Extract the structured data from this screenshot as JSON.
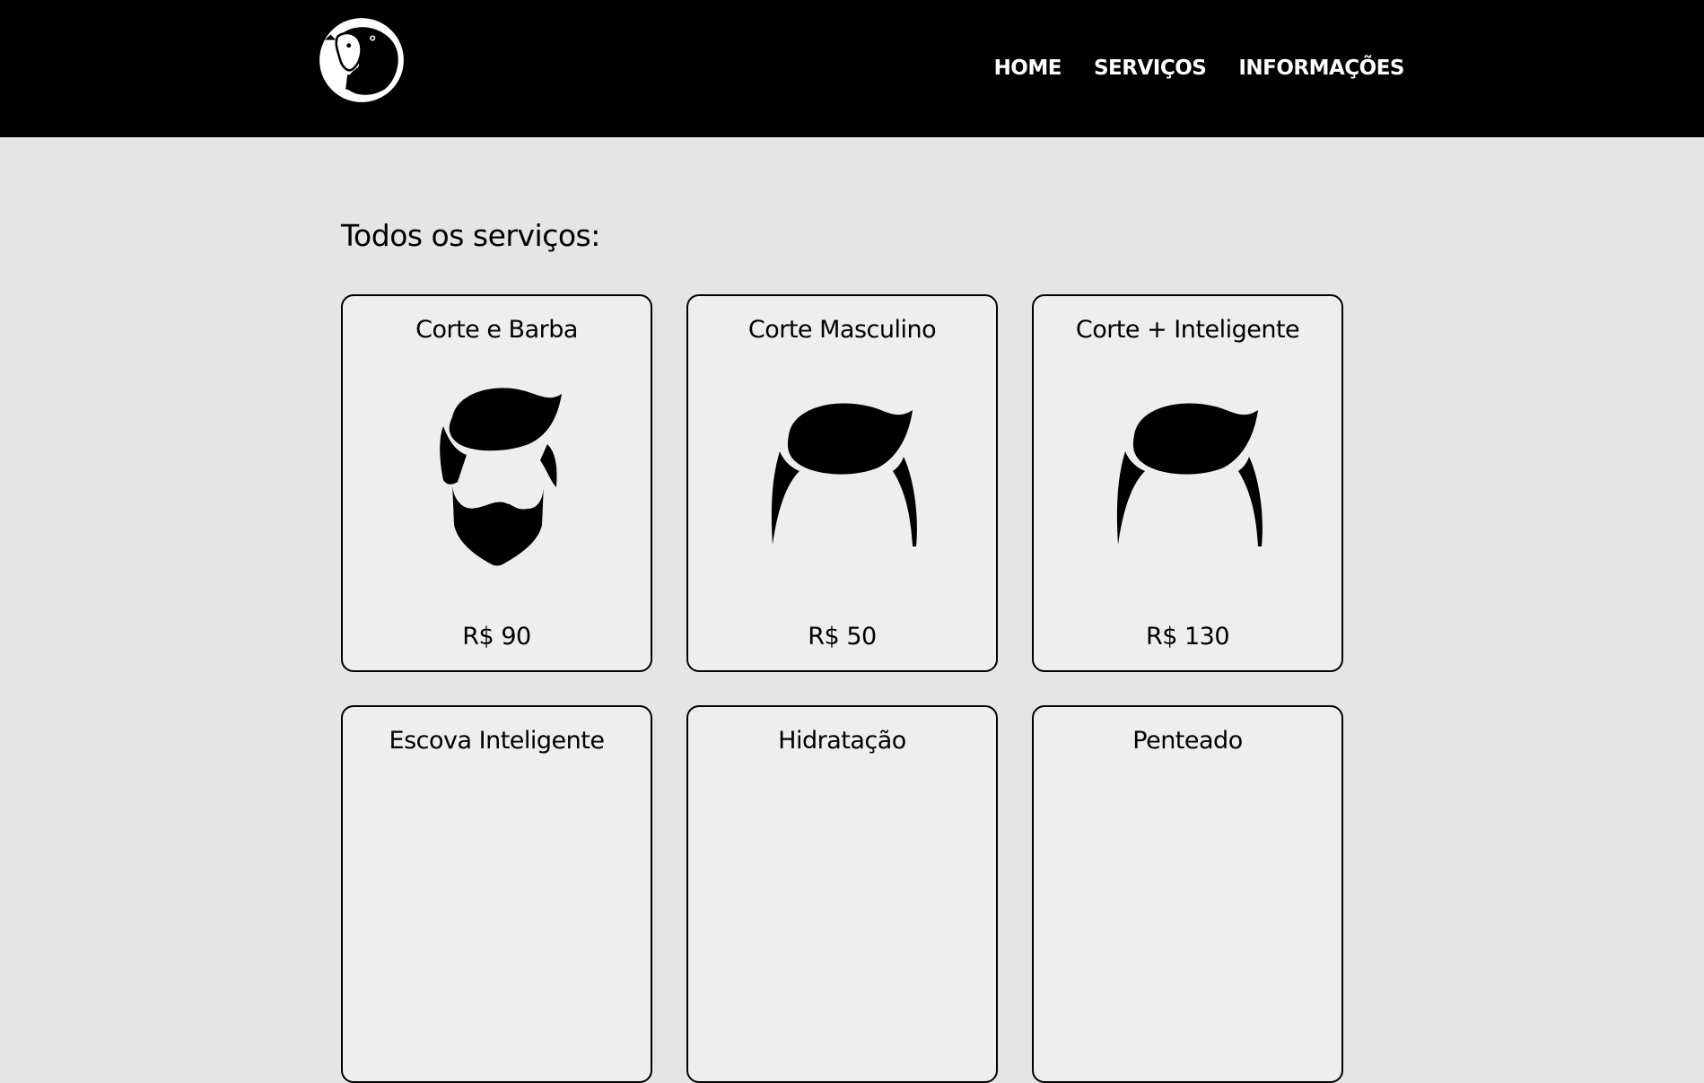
{
  "header": {
    "logo_icon": "sheep-logo-icon",
    "nav": [
      {
        "label": "HOME"
      },
      {
        "label": "SERVIÇOS"
      },
      {
        "label": "INFORMAÇÕES"
      }
    ]
  },
  "main": {
    "title": "Todos os serviços:",
    "services": [
      {
        "name": "Corte e Barba",
        "price": "R$ 90",
        "icon": "beard-hair-icon"
      },
      {
        "name": "Corte Masculino",
        "price": "R$ 50",
        "icon": "hair-icon"
      },
      {
        "name": "Corte + Inteligente",
        "price": "R$ 130",
        "icon": "hair-icon"
      },
      {
        "name": "Escova Inteligente",
        "price": "",
        "icon": ""
      },
      {
        "name": "Hidratação",
        "price": "",
        "icon": ""
      },
      {
        "name": "Penteado",
        "price": "",
        "icon": ""
      }
    ]
  },
  "colors": {
    "header_bg": "#000000",
    "page_bg": "#e5e5e5",
    "card_bg": "#eeeeee",
    "nav_text": "#ffffff"
  }
}
